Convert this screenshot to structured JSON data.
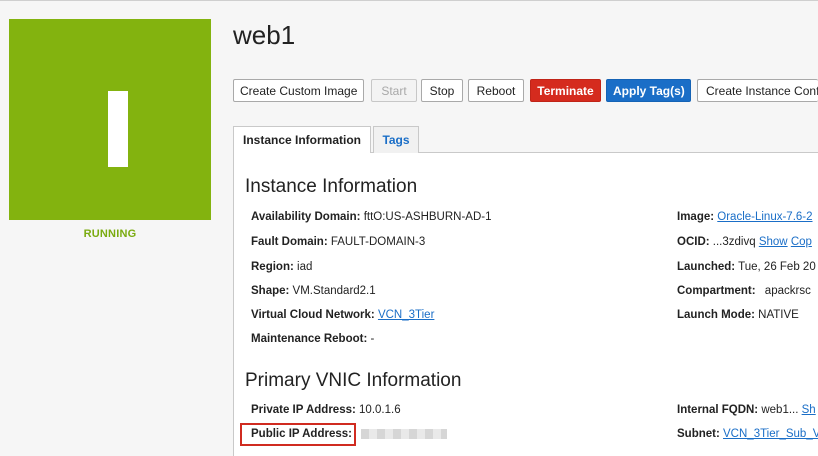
{
  "instance": {
    "name": "web1",
    "status": "RUNNING"
  },
  "colors": {
    "status_green": "#83b30f",
    "danger_red": "#d52b1e",
    "primary_blue": "#1a6ec7",
    "highlight_red": "#d02b20"
  },
  "toolbar": {
    "create_custom_image": "Create Custom Image",
    "start": "Start",
    "stop": "Stop",
    "reboot": "Reboot",
    "terminate": "Terminate",
    "apply_tags": "Apply Tag(s)",
    "create_instance_config": "Create Instance Conf"
  },
  "tabs": {
    "instance_information": "Instance Information",
    "tags": "Tags"
  },
  "instance_info": {
    "heading": "Instance Information",
    "availability_domain_label": "Availability Domain:",
    "availability_domain_value": "fttO:US-ASHBURN-AD-1",
    "fault_domain_label": "Fault Domain:",
    "fault_domain_value": "FAULT-DOMAIN-3",
    "region_label": "Region:",
    "region_value": "iad",
    "shape_label": "Shape:",
    "shape_value": "VM.Standard2.1",
    "vcn_label": "Virtual Cloud Network:",
    "vcn_value": "VCN_3Tier",
    "maintenance_reboot_label": "Maintenance Reboot:",
    "maintenance_reboot_value": "-",
    "image_label": "Image:",
    "image_value": "Oracle-Linux-7.6-2",
    "ocid_label": "OCID:",
    "ocid_value": "...3zdivq",
    "ocid_show": "Show",
    "ocid_copy": "Cop",
    "launched_label": "Launched:",
    "launched_value": "Tue, 26 Feb 20",
    "compartment_label": "Compartment:",
    "compartment_value": "apackrsc",
    "launch_mode_label": "Launch Mode:",
    "launch_mode_value": "NATIVE"
  },
  "vnic_info": {
    "heading": "Primary VNIC Information",
    "private_ip_label": "Private IP Address:",
    "private_ip_value": "10.0.1.6",
    "public_ip_label": "Public IP Address:",
    "internal_fqdn_label": "Internal FQDN:",
    "internal_fqdn_value": "web1...",
    "internal_fqdn_show": "Sh",
    "subnet_label": "Subnet:",
    "subnet_value": "VCN_3Tier_Sub_V"
  }
}
